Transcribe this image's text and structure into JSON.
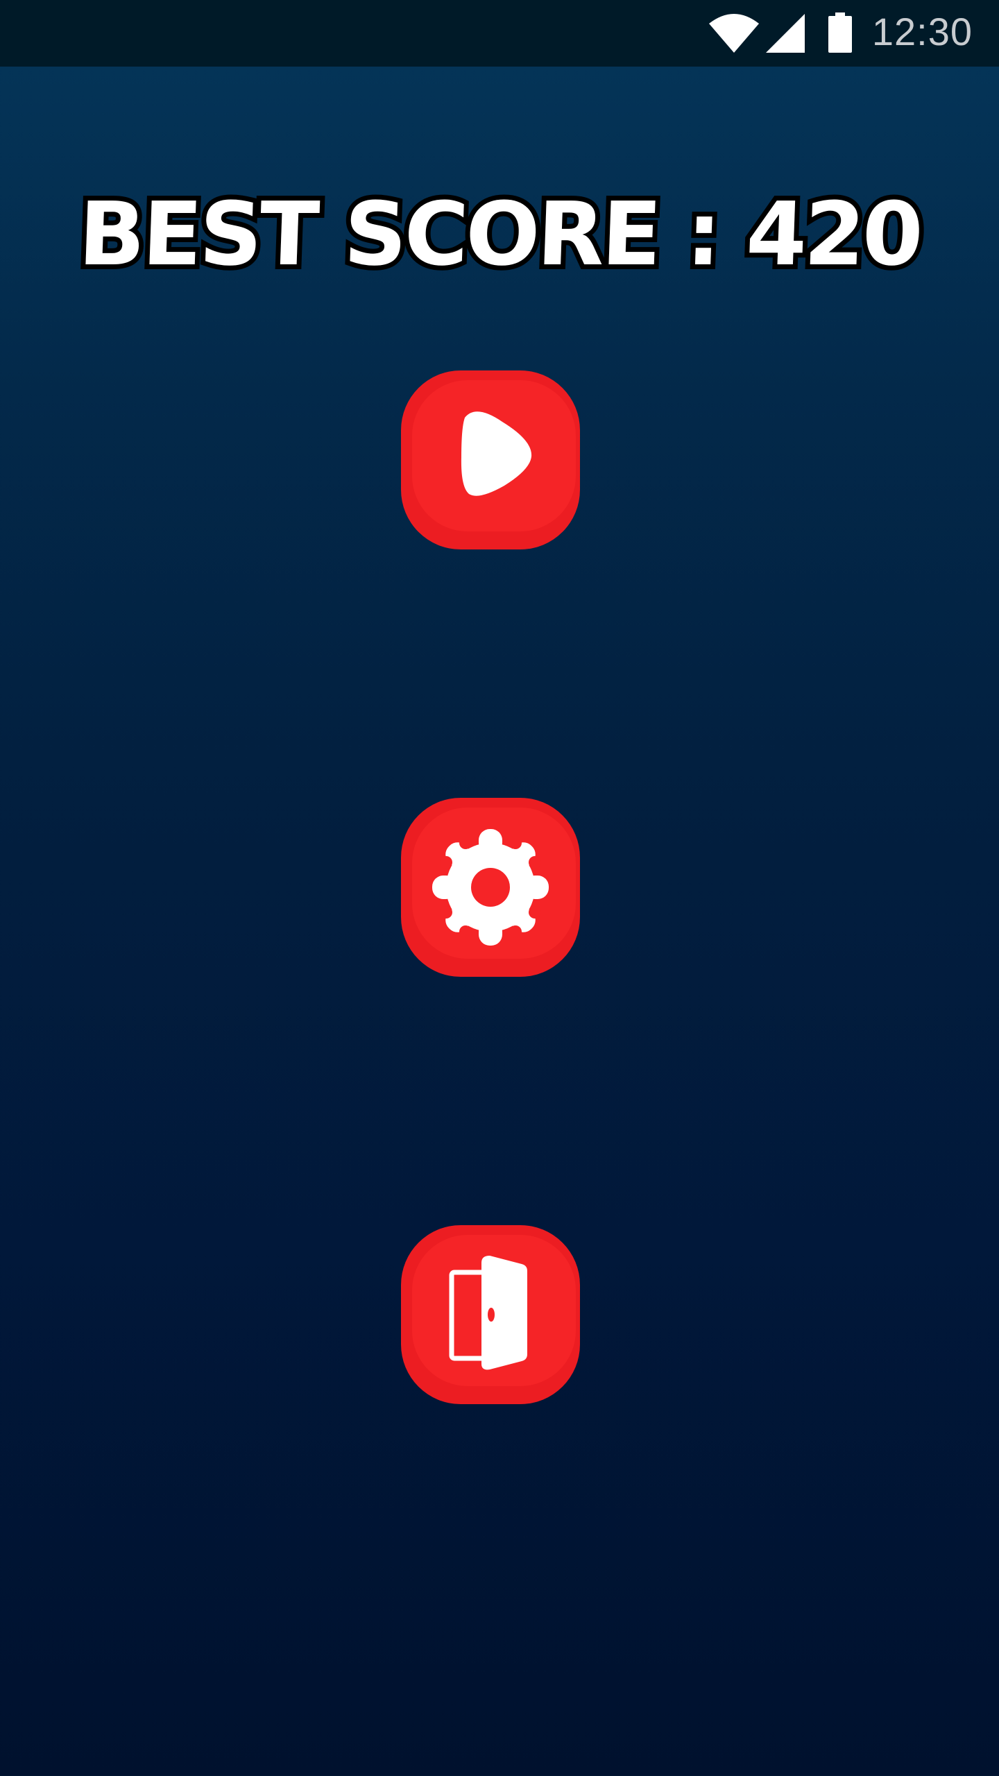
{
  "status_bar": {
    "time": "12:30",
    "icons": [
      "wifi-icon",
      "cell-signal-icon",
      "battery-icon"
    ]
  },
  "menu": {
    "best_score_text": "BEST SCORE : 420",
    "buttons": [
      {
        "id": "play",
        "icon": "play-icon"
      },
      {
        "id": "settings",
        "icon": "gear-icon"
      },
      {
        "id": "exit",
        "icon": "exit-door-icon"
      }
    ]
  },
  "colors": {
    "button_red": "#f52427",
    "background_top": "#04365a",
    "background_bottom": "#00112e",
    "status_bar": "#001a28"
  }
}
